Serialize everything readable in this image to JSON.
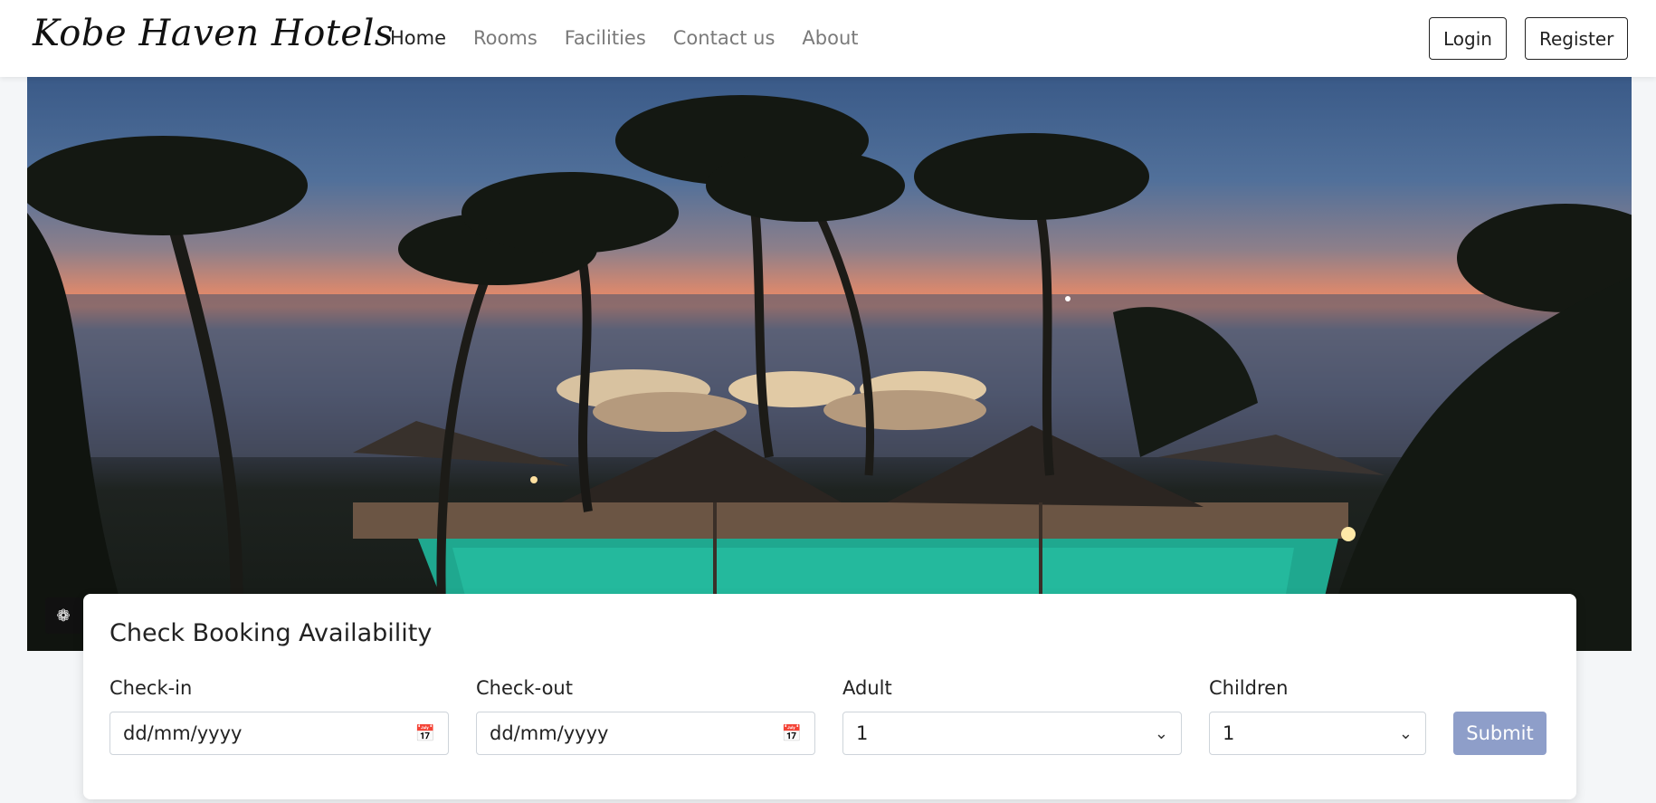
{
  "brand": "Kobe Haven Hotels",
  "nav": {
    "links": [
      "Home",
      "Rooms",
      "Facilities",
      "Contact us",
      "About"
    ],
    "active_index": 0
  },
  "auth": {
    "login": "Login",
    "register": "Register"
  },
  "booking": {
    "title": "Check Booking Availability",
    "checkin": {
      "label": "Check-in",
      "placeholder": "dd/mm/yyyy"
    },
    "checkout": {
      "label": "Check-out",
      "placeholder": "dd/mm/yyyy"
    },
    "adult": {
      "label": "Adult",
      "value": "1"
    },
    "children": {
      "label": "Children",
      "value": "1"
    },
    "submit": "Submit"
  },
  "icons": {
    "calendar": "calendar-icon",
    "chevron": "chevron-down-icon",
    "carousel": "carousel-control-icon"
  },
  "colors": {
    "submit_bg": "#8e9ec9",
    "nav_active": "#222222",
    "nav_inactive": "#7a7a7a"
  }
}
